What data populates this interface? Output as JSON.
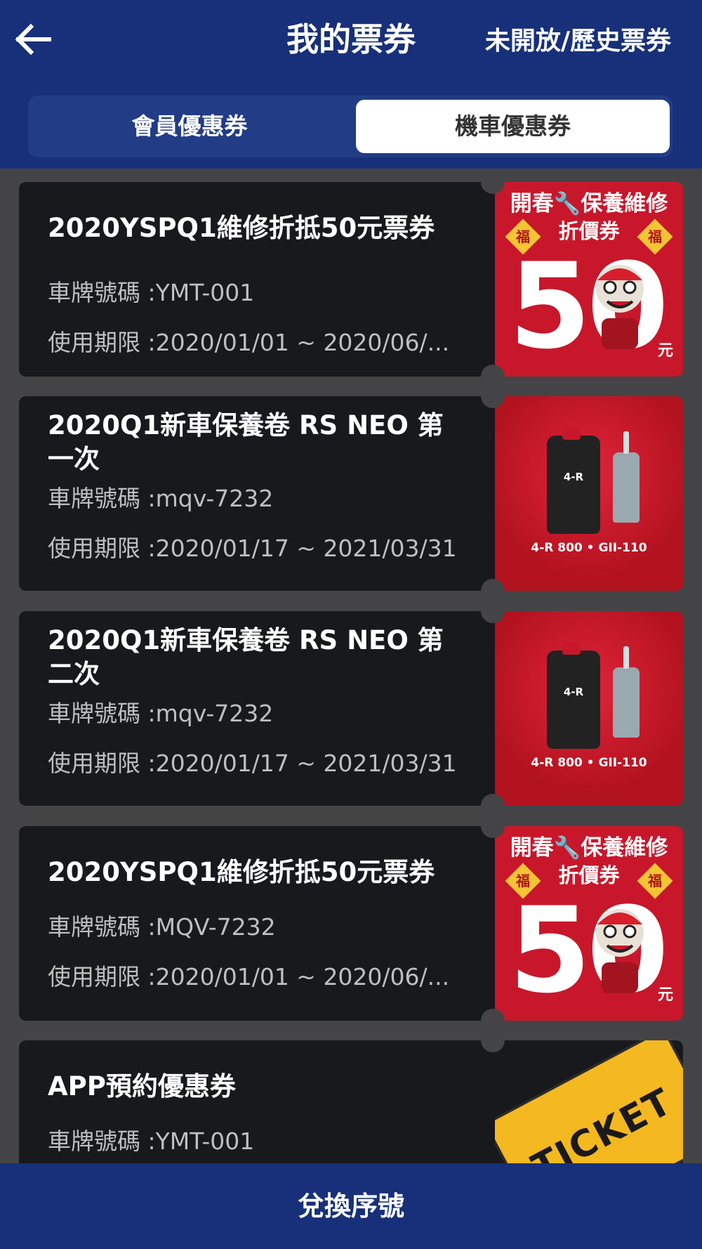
{
  "header": {
    "title": "我的票券",
    "history_link": "未開放/歷史票券"
  },
  "tabs": [
    {
      "label": "會員優惠券",
      "selected": false
    },
    {
      "label": "機車優惠券",
      "selected": true
    }
  ],
  "coupons": [
    {
      "title": "2020YSPQ1維修折抵50元票券",
      "plate": "車牌號碼 :YMT-001",
      "period": "使用期限 :2020/01/01 ~ 2020/06/...",
      "image": {
        "type": "promo",
        "line1": "開春🔧保養維修",
        "line2": "折價券",
        "amount": "50",
        "unit": "元",
        "badge": "福"
      }
    },
    {
      "title": "2020Q1新車保養卷 RS NEO 第一次",
      "plate": "車牌號碼 :mqv-7232",
      "period": "使用期限 :2020/01/17 ~ 2021/03/31",
      "image": {
        "type": "oil",
        "caption": "4-R 800 • GII-110",
        "bottle_label": "4-R"
      }
    },
    {
      "title": "2020Q1新車保養卷 RS NEO 第二次",
      "plate": "車牌號碼 :mqv-7232",
      "period": "使用期限 :2020/01/17 ~ 2021/03/31",
      "image": {
        "type": "oil",
        "caption": "4-R 800 • GII-110",
        "bottle_label": "4-R"
      }
    },
    {
      "title": "2020YSPQ1維修折抵50元票券",
      "plate": "車牌號碼 :MQV-7232",
      "period": "使用期限 :2020/01/01 ~ 2020/06/...",
      "image": {
        "type": "promo",
        "line1": "開春🔧保養維修",
        "line2": "折價券",
        "amount": "50",
        "unit": "元",
        "badge": "福"
      }
    },
    {
      "title": "APP預約優惠券",
      "plate": "車牌號碼 :YMT-001",
      "period": "",
      "image": {
        "type": "ticket",
        "text": "TICKET"
      }
    }
  ],
  "footer": {
    "redeem_label": "兌換序號"
  },
  "colors": {
    "header_bg": "#173079",
    "card_bg": "#18191d",
    "promo_red": "#c8172b",
    "page_bg": "#444446"
  }
}
